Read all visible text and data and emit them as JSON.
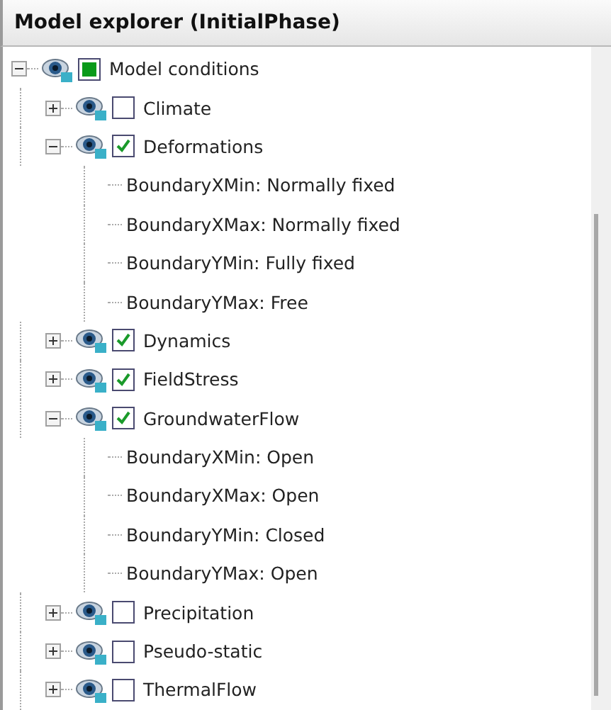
{
  "panel": {
    "title": "Model explorer (InitialPhase)"
  },
  "tree": [
    {
      "label": "Model conditions",
      "checked": false,
      "partial": true,
      "expanded": true,
      "children": [
        {
          "label": "Climate",
          "checked": false,
          "expanded": false
        },
        {
          "label": "Deformations",
          "checked": true,
          "expanded": true,
          "children": [
            {
              "label": "BoundaryXMin: Normally fixed"
            },
            {
              "label": "BoundaryXMax: Normally fixed"
            },
            {
              "label": "BoundaryYMin: Fully fixed"
            },
            {
              "label": "BoundaryYMax: Free"
            }
          ]
        },
        {
          "label": "Dynamics",
          "checked": true,
          "expanded": false
        },
        {
          "label": "FieldStress",
          "checked": true,
          "expanded": false
        },
        {
          "label": "GroundwaterFlow",
          "checked": true,
          "expanded": true,
          "children": [
            {
              "label": "BoundaryXMin: Open"
            },
            {
              "label": "BoundaryXMax: Open"
            },
            {
              "label": "BoundaryYMin: Closed"
            },
            {
              "label": "BoundaryYMax: Open"
            }
          ]
        },
        {
          "label": "Precipitation",
          "checked": false,
          "expanded": false
        },
        {
          "label": "Pseudo-static",
          "checked": false,
          "expanded": false
        },
        {
          "label": "ThermalFlow",
          "checked": false,
          "expanded": false
        }
      ]
    }
  ]
}
